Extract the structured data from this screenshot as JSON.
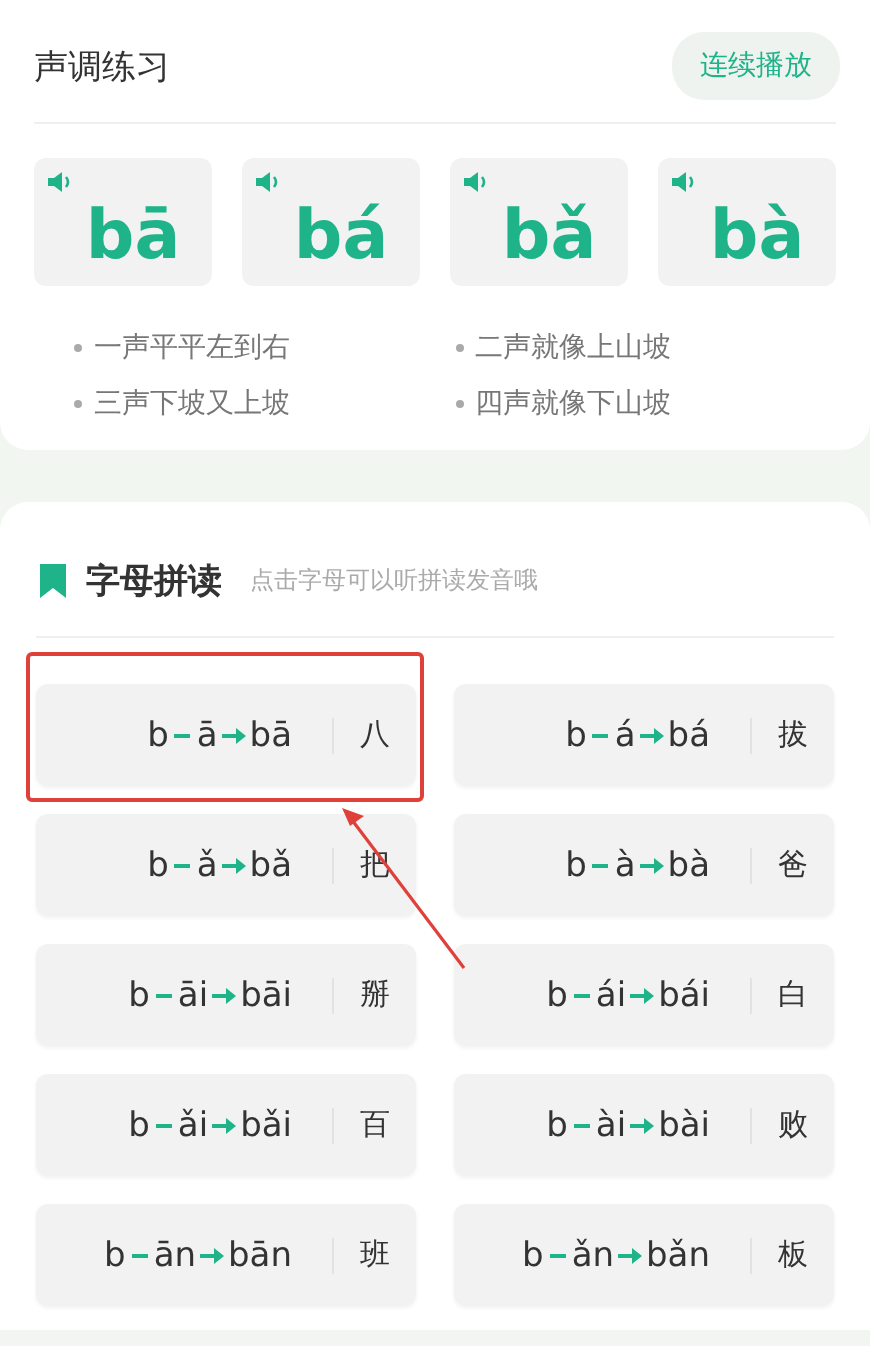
{
  "tone_practice": {
    "title": "声调练习",
    "play_button": "连续播放",
    "syllables": [
      {
        "text": "bā"
      },
      {
        "text": "bá"
      },
      {
        "text": "bǎ"
      },
      {
        "text": "bà"
      }
    ],
    "tips": [
      "一声平平左到右",
      "二声就像上山坡",
      "三声下坡又上坡",
      "四声就像下山坡"
    ]
  },
  "letter_spelling": {
    "title": "字母拼读",
    "hint": "点击字母可以听拼读发音哦",
    "items": [
      {
        "initial": "b",
        "final": "ā",
        "syllable": "bā",
        "character": "八",
        "highlighted": true
      },
      {
        "initial": "b",
        "final": "á",
        "syllable": "bá",
        "character": "拔",
        "highlighted": false
      },
      {
        "initial": "b",
        "final": "ǎ",
        "syllable": "bǎ",
        "character": "把",
        "highlighted": false
      },
      {
        "initial": "b",
        "final": "à",
        "syllable": "bà",
        "character": "爸",
        "highlighted": false
      },
      {
        "initial": "b",
        "final": "āi",
        "syllable": "bāi",
        "character": "掰",
        "highlighted": false
      },
      {
        "initial": "b",
        "final": "ái",
        "syllable": "bái",
        "character": "白",
        "highlighted": false
      },
      {
        "initial": "b",
        "final": "ǎi",
        "syllable": "bǎi",
        "character": "百",
        "highlighted": false
      },
      {
        "initial": "b",
        "final": "ài",
        "syllable": "bài",
        "character": "败",
        "highlighted": false
      },
      {
        "initial": "b",
        "final": "ān",
        "syllable": "bān",
        "character": "班",
        "highlighted": false
      },
      {
        "initial": "b",
        "final": "ǎn",
        "syllable": "bǎn",
        "character": "板",
        "highlighted": false
      }
    ]
  }
}
